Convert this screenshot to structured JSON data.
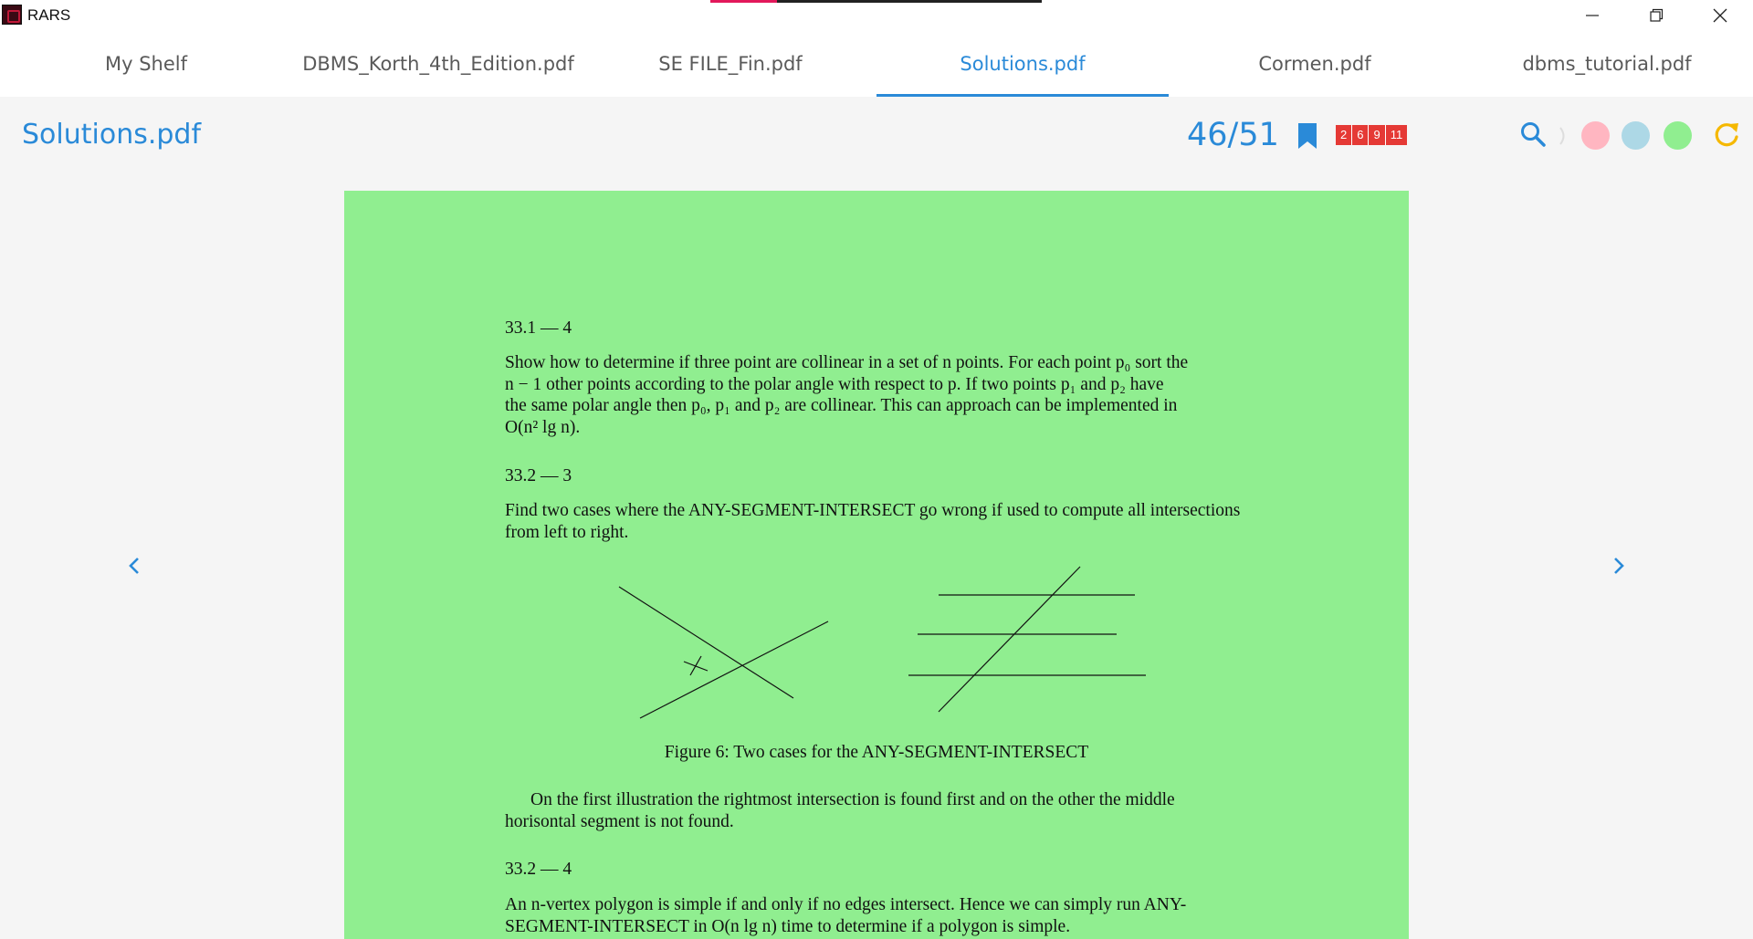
{
  "window": {
    "title": "RARS",
    "controls": [
      "minimize-icon",
      "restore-icon",
      "close-icon"
    ]
  },
  "tabs": [
    {
      "label": "My Shelf",
      "active": false
    },
    {
      "label": "DBMS_Korth_4th_Edition.pdf",
      "active": false
    },
    {
      "label": "SE FILE_Fin.pdf",
      "active": false
    },
    {
      "label": "Solutions.pdf",
      "active": true
    },
    {
      "label": "Cormen.pdf",
      "active": false
    },
    {
      "label": "dbms_tutorial.pdf",
      "active": false
    }
  ],
  "toolbar": {
    "doc_title": "Solutions.pdf",
    "page_counter": "46/51",
    "bookmarks": [
      "2",
      "6",
      "9",
      "11"
    ],
    "highlight_colors": [
      "#ffb6c1",
      "#add8e6",
      "#90ee90"
    ],
    "accent_color": "#2a8ad8",
    "refresh_color": "#f5b800"
  },
  "page": {
    "background": "#90ee90",
    "h1": "33.1 — 4",
    "p1_lines": [
      "Show how to determine if three point are collinear in a set of n points. For each point p₀ sort the",
      "n − 1 other points according to the polar angle with respect to p.  If two points p₁ and p₂ have",
      "the same polar angle then p₀, p₁ and p₂ are collinear. This can approach can be implemented in",
      "O(n² lg n)."
    ],
    "h2": "33.2 — 3",
    "p2_lines": [
      "Find two cases where the ANY-SEGMENT-INTERSECT go wrong if used to compute all intersections",
      "from left to right."
    ],
    "figure_caption": "Figure 6: Two cases for the ANY-SEGMENT-INTERSECT",
    "p3_lines": [
      "On the first illustration the rightmost intersection is found first and on the other the middle",
      "horisontal segment is not found."
    ],
    "h3": "33.2 — 4",
    "p4_lines": [
      "An n-vertex polygon is simple if and only if no edges intersect.  Hence we can simply run ANY-",
      "SEGMENT-INTERSECT in O(n lg n) time to determine if a polygon is simple."
    ]
  }
}
